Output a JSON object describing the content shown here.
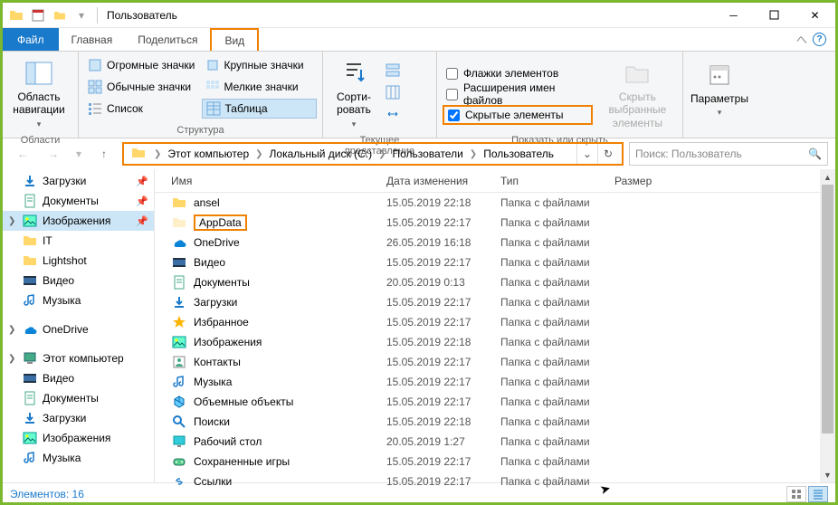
{
  "window": {
    "title": "Пользователь"
  },
  "tabs": {
    "file": "Файл",
    "home": "Главная",
    "share": "Поделиться",
    "view": "Вид"
  },
  "ribbon": {
    "panes": {
      "label": "Области",
      "navPane": "Область навигации"
    },
    "layout": {
      "label": "Структура",
      "huge": "Огромные значки",
      "large": "Крупные значки",
      "normal": "Обычные значки",
      "small": "Мелкие значки",
      "list": "Список",
      "table": "Таблица"
    },
    "currentView": {
      "label": "Текущее представление",
      "sort": "Сорти-ровать"
    },
    "showHide": {
      "label": "Показать или скрыть",
      "itemCheck": "Флажки элементов",
      "fileExt": "Расширения имен файлов",
      "hidden": "Скрытые элементы",
      "hideSelected": "Скрыть выбранные элементы"
    },
    "options": "Параметры"
  },
  "breadcrumb": [
    "Этот компьютер",
    "Локальный диск (C:)",
    "Пользователи",
    "Пользователь"
  ],
  "search": {
    "placeholder": "Поиск: Пользователь"
  },
  "nav": [
    {
      "name": "Загрузки",
      "icon": "download",
      "pin": true
    },
    {
      "name": "Документы",
      "icon": "doc",
      "pin": true
    },
    {
      "name": "Изображения",
      "icon": "image",
      "pin": true,
      "sel": true,
      "exp": true
    },
    {
      "name": "IT",
      "icon": "folder"
    },
    {
      "name": "Lightshot",
      "icon": "folder"
    },
    {
      "name": "Видео",
      "icon": "video"
    },
    {
      "name": "Музыка",
      "icon": "music"
    },
    {
      "sp": true
    },
    {
      "name": "OneDrive",
      "icon": "onedrive",
      "exp": true
    },
    {
      "sp": true
    },
    {
      "name": "Этот компьютер",
      "icon": "pc",
      "exp": true
    },
    {
      "name": "Видео",
      "icon": "video"
    },
    {
      "name": "Документы",
      "icon": "doc"
    },
    {
      "name": "Загрузки",
      "icon": "download"
    },
    {
      "name": "Изображения",
      "icon": "image"
    },
    {
      "name": "Музыка",
      "icon": "music"
    }
  ],
  "cols": {
    "name": "Имя",
    "date": "Дата изменения",
    "type": "Тип",
    "size": "Размер"
  },
  "items": [
    {
      "name": "ansel",
      "icon": "folder",
      "date": "15.05.2019 22:18",
      "type": "Папка с файлами"
    },
    {
      "name": "AppData",
      "icon": "folder-dim",
      "date": "15.05.2019 22:17",
      "type": "Папка с файлами",
      "hl": true
    },
    {
      "name": "OneDrive",
      "icon": "onedrive",
      "date": "26.05.2019 16:18",
      "type": "Папка с файлами"
    },
    {
      "name": "Видео",
      "icon": "video",
      "date": "15.05.2019 22:17",
      "type": "Папка с файлами"
    },
    {
      "name": "Документы",
      "icon": "doc",
      "date": "20.05.2019 0:13",
      "type": "Папка с файлами"
    },
    {
      "name": "Загрузки",
      "icon": "download",
      "date": "15.05.2019 22:17",
      "type": "Папка с файлами"
    },
    {
      "name": "Избранное",
      "icon": "star",
      "date": "15.05.2019 22:17",
      "type": "Папка с файлами"
    },
    {
      "name": "Изображения",
      "icon": "image",
      "date": "15.05.2019 22:18",
      "type": "Папка с файлами"
    },
    {
      "name": "Контакты",
      "icon": "contact",
      "date": "15.05.2019 22:17",
      "type": "Папка с файлами"
    },
    {
      "name": "Музыка",
      "icon": "music",
      "date": "15.05.2019 22:17",
      "type": "Папка с файлами"
    },
    {
      "name": "Объемные объекты",
      "icon": "3d",
      "date": "15.05.2019 22:17",
      "type": "Папка с файлами"
    },
    {
      "name": "Поиски",
      "icon": "search",
      "date": "15.05.2019 22:18",
      "type": "Папка с файлами"
    },
    {
      "name": "Рабочий стол",
      "icon": "desktop",
      "date": "20.05.2019 1:27",
      "type": "Папка с файлами"
    },
    {
      "name": "Сохраненные игры",
      "icon": "games",
      "date": "15.05.2019 22:17",
      "type": "Папка с файлами"
    },
    {
      "name": "Ссылки",
      "icon": "link",
      "date": "15.05.2019 22:17",
      "type": "Папка с файлами"
    }
  ],
  "status": {
    "count": "Элементов: 16"
  }
}
